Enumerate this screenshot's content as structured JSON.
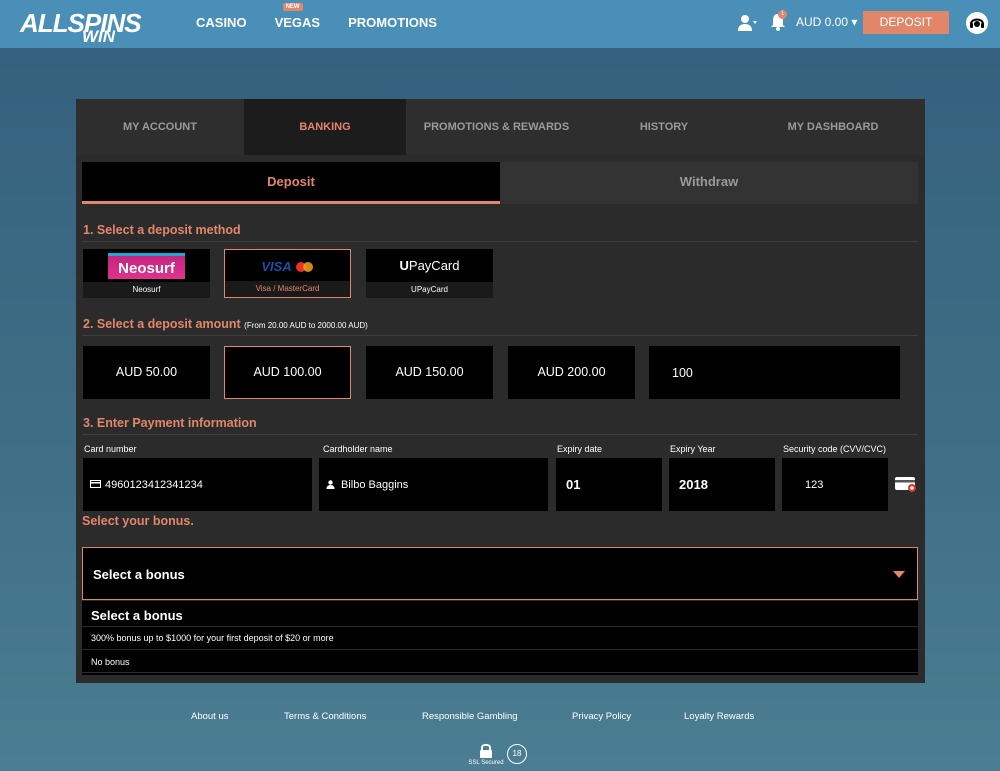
{
  "header": {
    "logo_line1": "ALLSPINS",
    "logo_line2": "WIN",
    "nav": [
      {
        "label": "CASINO"
      },
      {
        "label": "VEGAS",
        "badge": "NEW"
      },
      {
        "label": "PROMOTIONS"
      }
    ],
    "notification_count": "1",
    "balance": "AUD 0.00",
    "deposit_label": "DEPOSIT"
  },
  "tabs": [
    "MY ACCOUNT",
    "BANKING",
    "PROMOTIONS & REWARDS",
    "HISTORY",
    "MY DASHBOARD"
  ],
  "active_tab": "BANKING",
  "subtabs": {
    "deposit": "Deposit",
    "withdraw": "Withdraw"
  },
  "section1": {
    "title": "1. Select a deposit method",
    "methods": [
      {
        "label": "Neosurf",
        "logo": "Neosurf"
      },
      {
        "label": "Visa / MasterCard",
        "logo": "VISA",
        "selected": true
      },
      {
        "label": "UPayCard",
        "logo_u": "U",
        "logo_rest": "PayCard"
      }
    ]
  },
  "section2": {
    "title": "2. Select a deposit amount",
    "subtitle": "(From 20.00 AUD to 2000.00 AUD)",
    "amounts": [
      "AUD 50.00",
      "AUD 100.00",
      "AUD 150.00",
      "AUD 200.00"
    ],
    "selected_amount": "AUD 100.00",
    "custom_amount": "100"
  },
  "section3": {
    "title": "3. Enter Payment information",
    "card_number_label": "Card number",
    "card_number": "4960123412341234",
    "holder_label": "Cardholder name",
    "holder": "Bilbo Baggins",
    "expiry_label": "Expiry date",
    "expiry": "01",
    "year_label": "Expiry Year",
    "year": "2018",
    "cvv_label": "Security code (CVV/CVC)",
    "cvv": "123"
  },
  "bonus": {
    "title": "Select your bonus.",
    "select_value": "Select a bonus",
    "options": [
      "Select a bonus",
      "300% bonus up to $1000 for your first deposit of $20 or more",
      "No bonus"
    ]
  },
  "footer": {
    "links": [
      "About us",
      "Terms & Conditions",
      "Responsible Gambling",
      "Privacy Policy",
      "Loyalty Rewards"
    ],
    "ssl": "SSL Secured",
    "age": "18"
  },
  "colors": {
    "accent": "#e2866a",
    "header": "#4a8fb8",
    "panel": "#2b2b2b"
  }
}
